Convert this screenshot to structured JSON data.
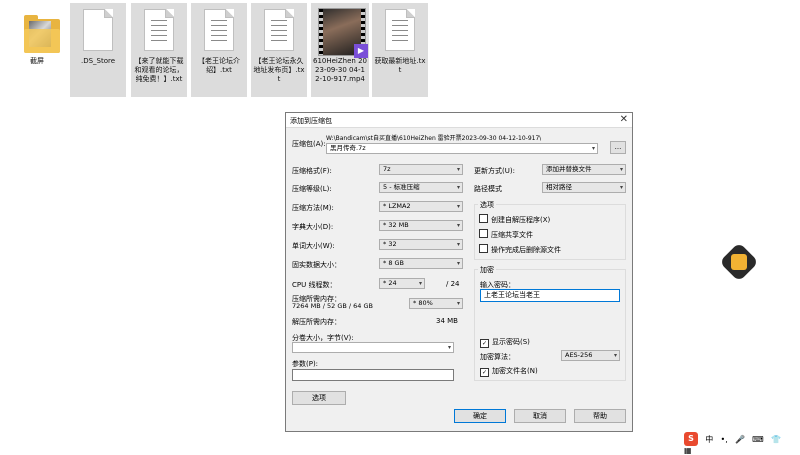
{
  "desktop": {
    "files": [
      {
        "name": "截屏"
      },
      {
        "name": ".DS_Store"
      },
      {
        "name": "【来了就能下载和观看的论坛，纯免费！】.txt"
      },
      {
        "name": "【老王论坛介绍】.txt"
      },
      {
        "name": "【老王论坛永久地址发布页】.txt"
      },
      {
        "name": "610HeiZhen 2023-09-30 04-12-10-917.mp4"
      },
      {
        "name": "获取最新地址.txt"
      }
    ]
  },
  "dialog": {
    "title": "添加到压缩包",
    "archive_label": "压缩包(A):",
    "archive_path": "W:\\Bandicam\\st自买直播\\610HeiZhen 雷验开票2023-09-30 04-12-10-917\\",
    "archive_name": "黑月传奇.7z",
    "browse_label": "...",
    "format_label": "压缩格式(F):",
    "format_value": "7z",
    "level_label": "压缩等级(L):",
    "level_value": "5 - 标准压缩",
    "method_label": "压缩方法(M):",
    "method_value": "* LZMA2",
    "dict_label": "字典大小(D):",
    "dict_value": "* 32 MB",
    "word_label": "单词大小(W):",
    "word_value": "* 32",
    "solid_label": "固实数据大小：",
    "solid_value": "* 8 GB",
    "cpu_label": "CPU 线程数：",
    "cpu_value": "* 24",
    "cpu_total": "/ 24",
    "mem_label": "压缩所需内存：",
    "mem_value": "7264 MB / 52 GB / 64 GB",
    "mem_pct": "* 80%",
    "decomp_label": "解压所需内存：",
    "decomp_value": "34 MB",
    "split_label": "分卷大小，字节(V):",
    "split_value": "",
    "params_label": "参数(P):",
    "params_value": "",
    "options_btn": "选项",
    "update_label": "更新方式(U):",
    "update_value": "添加并替换文件",
    "path_label": "路径模式",
    "path_value": "相对路径",
    "options_group": "选项",
    "opt_sfx": "创建自解压程序(X)",
    "opt_shared": "压缩共享文件",
    "opt_delete": "操作完成后删除源文件",
    "encrypt_group": "加密",
    "pwd_label": "输入密码：",
    "pwd_value": "上老王论坛当老王",
    "show_pwd": "显示密码(S)",
    "enc_method_label": "加密算法：",
    "enc_method_value": "AES-256",
    "enc_names": "加密文件名(N)",
    "ok": "确定",
    "cancel": "取消",
    "help": "帮助"
  },
  "tray": {
    "ime": "中",
    "punct": "•,",
    "sougou": "S"
  }
}
